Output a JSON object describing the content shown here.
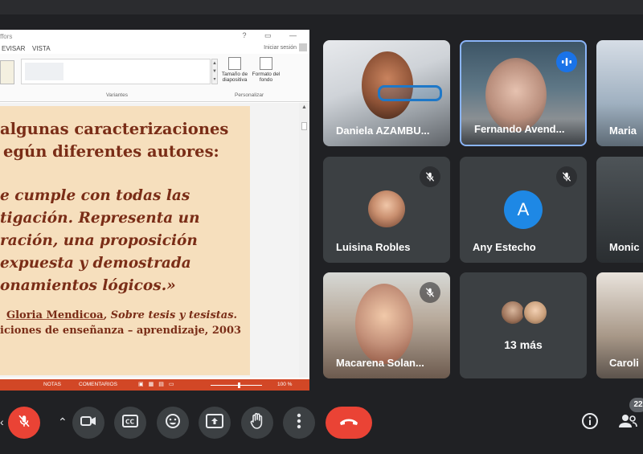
{
  "window": {
    "title_fragment": "ffors",
    "controls": "? ▭ —",
    "signin": "Iniciar sesión"
  },
  "ribbon": {
    "tab_revisar": "EVISAR",
    "tab_vista": "VISTA",
    "btn_slide_size": "Tamaño de diapositiva",
    "btn_bg_format": "Formato del fondo",
    "group_variants": "Variantes",
    "group_customize": "Personalizar"
  },
  "slide": {
    "heading_line1": "algunas caracterizaciones",
    "heading_line2": "egún diferentes autores:",
    "quote_line1": "e  cumple  con  todas  las",
    "quote_line2": "tigación.  Representa  un",
    "quote_line3": "ración,  una  proposición",
    "quote_line4": " expuesta  y  demostrada",
    "quote_line5": "onamientos lógicos.»",
    "cite_author": "Gloria Mendicoa",
    "cite_rest": ", Sobre tesis y tesistas.",
    "cite_line2": "iciones de enseñanza – aprendizaje, 2003"
  },
  "status_bar": {
    "notes": "NOTAS",
    "comments": "COMENTARIOS",
    "zoom": "100 %"
  },
  "participants": [
    {
      "name": "Daniela AZAMBU...",
      "muted": false,
      "speaking": false
    },
    {
      "name": "Fernando Avend...",
      "muted": false,
      "speaking": true
    },
    {
      "name": "Maria",
      "muted": false,
      "speaking": false
    },
    {
      "name": "Luisina Robles",
      "muted": true,
      "speaking": false
    },
    {
      "name": "Any Estecho",
      "muted": true,
      "speaking": false,
      "initial": "A"
    },
    {
      "name": "Monic",
      "muted": false,
      "speaking": false
    },
    {
      "name": "Macarena Solan...",
      "muted": true,
      "speaking": false
    },
    {
      "name": "Caroli",
      "muted": false,
      "speaking": false
    }
  ],
  "more_tile": {
    "label": "13 más"
  },
  "toolbar": {
    "people_count": "22"
  },
  "colors": {
    "background": "#202124",
    "tile": "#3c4043",
    "danger": "#ea4335",
    "accent": "#1a73e8",
    "slide_bg": "#f6dfbd",
    "slide_text": "#7a2d17",
    "ppt_status": "#d24726"
  },
  "icons": [
    "mic-off-icon",
    "camera-icon",
    "captions-icon",
    "emoji-icon",
    "present-icon",
    "raise-hand-icon",
    "more-options-icon",
    "end-call-icon",
    "info-icon",
    "people-icon",
    "speaking-icon"
  ]
}
